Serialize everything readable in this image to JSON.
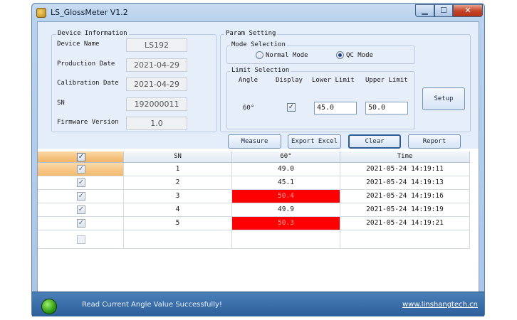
{
  "window": {
    "title": "LS_GlossMeter V1.2",
    "min_glyph": "▁",
    "max_glyph": "☐",
    "close_glyph": "✕"
  },
  "device_info": {
    "group_label": "Device Information",
    "fields": [
      {
        "label": "Device Name",
        "value": "LS192"
      },
      {
        "label": "Production Date",
        "value": "2021-04-29"
      },
      {
        "label": "Calibration Date",
        "value": "2021-04-29"
      },
      {
        "label": "SN",
        "value": "192000011"
      },
      {
        "label": "Firmware  Version",
        "value": "1.0"
      }
    ]
  },
  "param_setting": {
    "group_label": "Param Setting",
    "mode_selection": {
      "group_label": "Mode Selection",
      "options": [
        {
          "label": "Normal Mode",
          "selected": false
        },
        {
          "label": "QC Mode",
          "selected": true
        }
      ]
    },
    "limit_selection": {
      "group_label": "Limit Selection",
      "headers": {
        "angle": "Angle",
        "display": "Display",
        "lower": "Lower Limit",
        "upper": "Upper Limit"
      },
      "angle": "60°",
      "display_checked": true,
      "lower_limit": "45.0",
      "upper_limit": "50.0"
    },
    "setup_label": "Setup"
  },
  "actions": {
    "measure": "Measure",
    "export": "Export Excel",
    "clear": "Clear",
    "report": "Report"
  },
  "table": {
    "columns": [
      "SN",
      "60°",
      "Time"
    ],
    "rows": [
      {
        "sn": "1",
        "value": "49.0",
        "time": "2021-05-24 14:19:11",
        "checked": true,
        "alarm": false
      },
      {
        "sn": "2",
        "value": "45.1",
        "time": "2021-05-24 14:19:13",
        "checked": true,
        "alarm": false
      },
      {
        "sn": "3",
        "value": "50.4",
        "time": "2021-05-24 14:19:16",
        "checked": true,
        "alarm": true
      },
      {
        "sn": "4",
        "value": "49.9",
        "time": "2021-05-24 14:19:19",
        "checked": true,
        "alarm": false
      },
      {
        "sn": "5",
        "value": "50.3",
        "time": "2021-05-24 14:19:21",
        "checked": true,
        "alarm": true
      }
    ]
  },
  "status": {
    "message": "Read Current Angle Value Successfully!",
    "link": "www.linshangtech.cn"
  },
  "colors": {
    "alarm": "#ff0000",
    "status_bar": "#2d5f99",
    "selection": "#f3b96b"
  },
  "glyphs": {
    "check": "✓"
  }
}
